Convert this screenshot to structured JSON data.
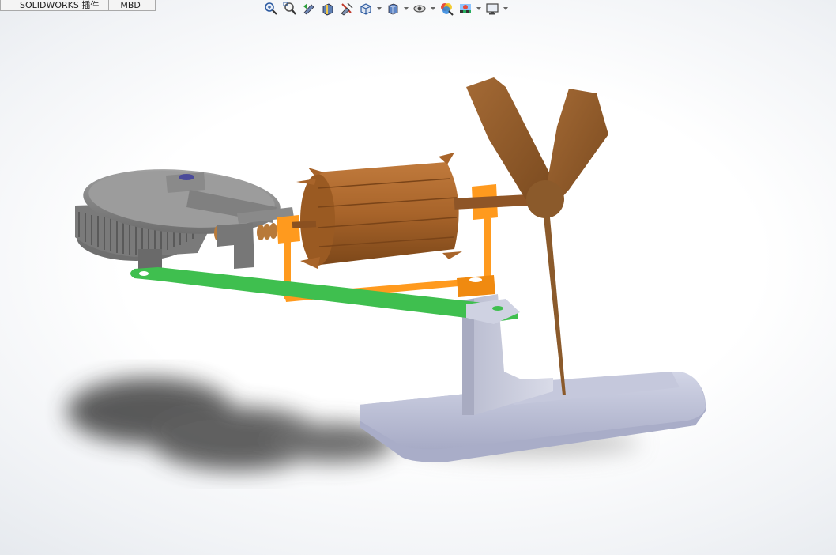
{
  "tabs": [
    {
      "label": "SOLIDWORKS 插件"
    },
    {
      "label": "MBD"
    }
  ],
  "heads_up_toolbar": {
    "tools": [
      {
        "icon": "zoom-to-fit-icon"
      },
      {
        "icon": "zoom-to-area-icon"
      },
      {
        "icon": "previous-view-icon"
      },
      {
        "icon": "section-view-icon"
      },
      {
        "icon": "dynamic-annotation-views-icon"
      },
      {
        "icon": "view-orientation-icon",
        "has_dropdown": true
      },
      {
        "icon": "display-style-icon",
        "has_dropdown": true
      },
      {
        "icon": "hide-show-items-icon",
        "has_dropdown": true
      },
      {
        "icon": "edit-appearance-icon"
      },
      {
        "icon": "apply-scene-icon",
        "has_dropdown": true
      },
      {
        "icon": "view-settings-icon",
        "has_dropdown": true
      }
    ]
  },
  "model": {
    "description_parts": [
      "gear-wheel",
      "linkage-bar",
      "motor-rotor",
      "fan-blades",
      "support-bracket",
      "base-plate",
      "frame"
    ],
    "colors": {
      "gear": "#8c8c8c",
      "linkage": "#3fbf4f",
      "frame": "#ff9a1e",
      "rotor": "#a8642a",
      "blades": "#8b5a2b",
      "bracket": "#c8cada",
      "base": "#b9bcd3",
      "shadow": "#444444"
    }
  }
}
